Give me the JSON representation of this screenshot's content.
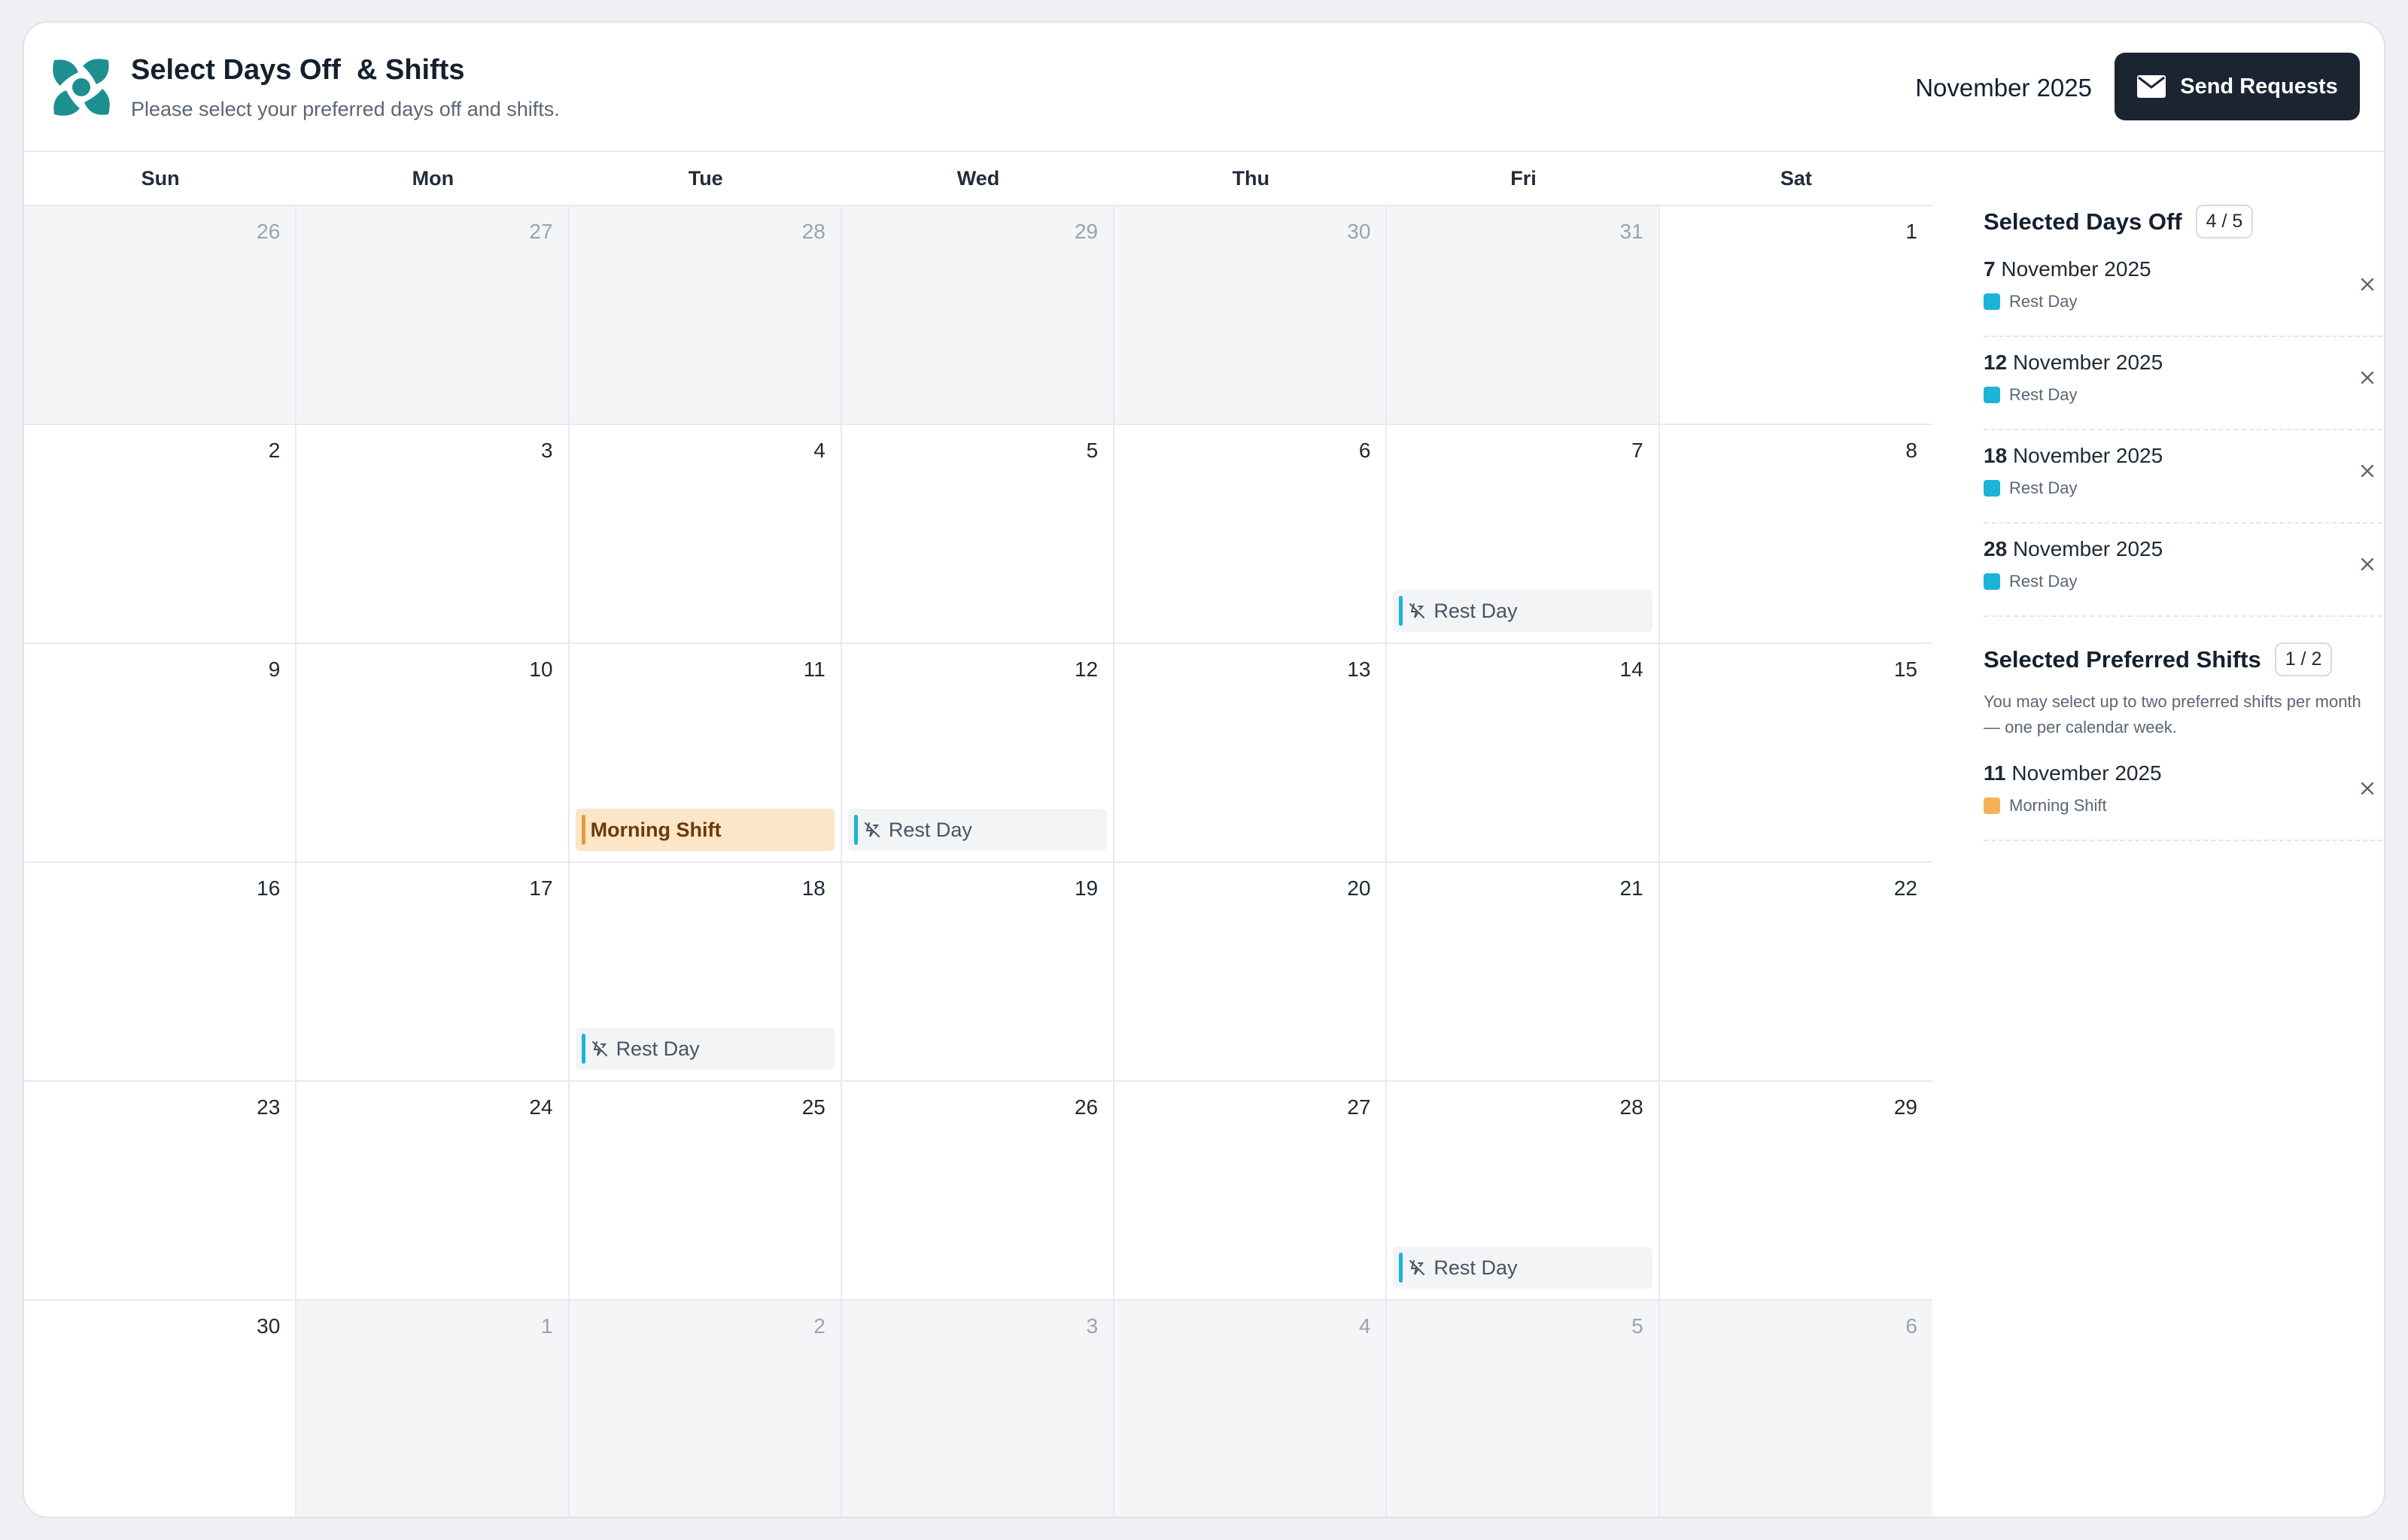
{
  "header": {
    "title": "Select Days Off  & Shifts",
    "subtitle": "Please select your preferred days off and shifts.",
    "month": "November 2025",
    "send_label": "Send Requests"
  },
  "colors": {
    "brand": "#1e8f91",
    "rest": "#1bb4d8",
    "shift": "#f5b25a",
    "button": "#1b2531"
  },
  "calendar": {
    "weekdays": [
      "Sun",
      "Mon",
      "Tue",
      "Wed",
      "Thu",
      "Fri",
      "Sat"
    ],
    "days": [
      {
        "num": "26",
        "outside": true
      },
      {
        "num": "27",
        "outside": true
      },
      {
        "num": "28",
        "outside": true
      },
      {
        "num": "29",
        "outside": true
      },
      {
        "num": "30",
        "outside": true
      },
      {
        "num": "31",
        "outside": true
      },
      {
        "num": "1"
      },
      {
        "num": "2"
      },
      {
        "num": "3"
      },
      {
        "num": "4"
      },
      {
        "num": "5"
      },
      {
        "num": "6"
      },
      {
        "num": "7",
        "event": {
          "type": "rest",
          "label": "Rest Day"
        }
      },
      {
        "num": "8"
      },
      {
        "num": "9"
      },
      {
        "num": "10"
      },
      {
        "num": "11",
        "event": {
          "type": "shift",
          "label": "Morning Shift"
        }
      },
      {
        "num": "12",
        "event": {
          "type": "rest",
          "label": "Rest Day"
        }
      },
      {
        "num": "13"
      },
      {
        "num": "14"
      },
      {
        "num": "15"
      },
      {
        "num": "16"
      },
      {
        "num": "17"
      },
      {
        "num": "18",
        "event": {
          "type": "rest",
          "label": "Rest Day"
        }
      },
      {
        "num": "19"
      },
      {
        "num": "20"
      },
      {
        "num": "21"
      },
      {
        "num": "22"
      },
      {
        "num": "23"
      },
      {
        "num": "24"
      },
      {
        "num": "25"
      },
      {
        "num": "26"
      },
      {
        "num": "27"
      },
      {
        "num": "28",
        "event": {
          "type": "rest",
          "label": "Rest Day"
        }
      },
      {
        "num": "29"
      },
      {
        "num": "30"
      },
      {
        "num": "1",
        "outside": true
      },
      {
        "num": "2",
        "outside": true
      },
      {
        "num": "3",
        "outside": true
      },
      {
        "num": "4",
        "outside": true
      },
      {
        "num": "5",
        "outside": true
      },
      {
        "num": "6",
        "outside": true
      }
    ]
  },
  "sidebar": {
    "days_off": {
      "title": "Selected Days Off",
      "count": "4 / 5",
      "items": [
        {
          "day": "7",
          "rest": "November 2025",
          "tag": "Rest Day"
        },
        {
          "day": "12",
          "rest": "November 2025",
          "tag": "Rest Day"
        },
        {
          "day": "18",
          "rest": "November 2025",
          "tag": "Rest Day"
        },
        {
          "day": "28",
          "rest": "November 2025",
          "tag": "Rest Day"
        }
      ]
    },
    "shifts": {
      "title": "Selected Preferred Shifts",
      "count": "1 / 2",
      "note": "You may select up to two preferred shifts per month — one per calendar week.",
      "items": [
        {
          "day": "11",
          "rest": "November 2025",
          "tag": "Morning Shift"
        }
      ]
    }
  }
}
